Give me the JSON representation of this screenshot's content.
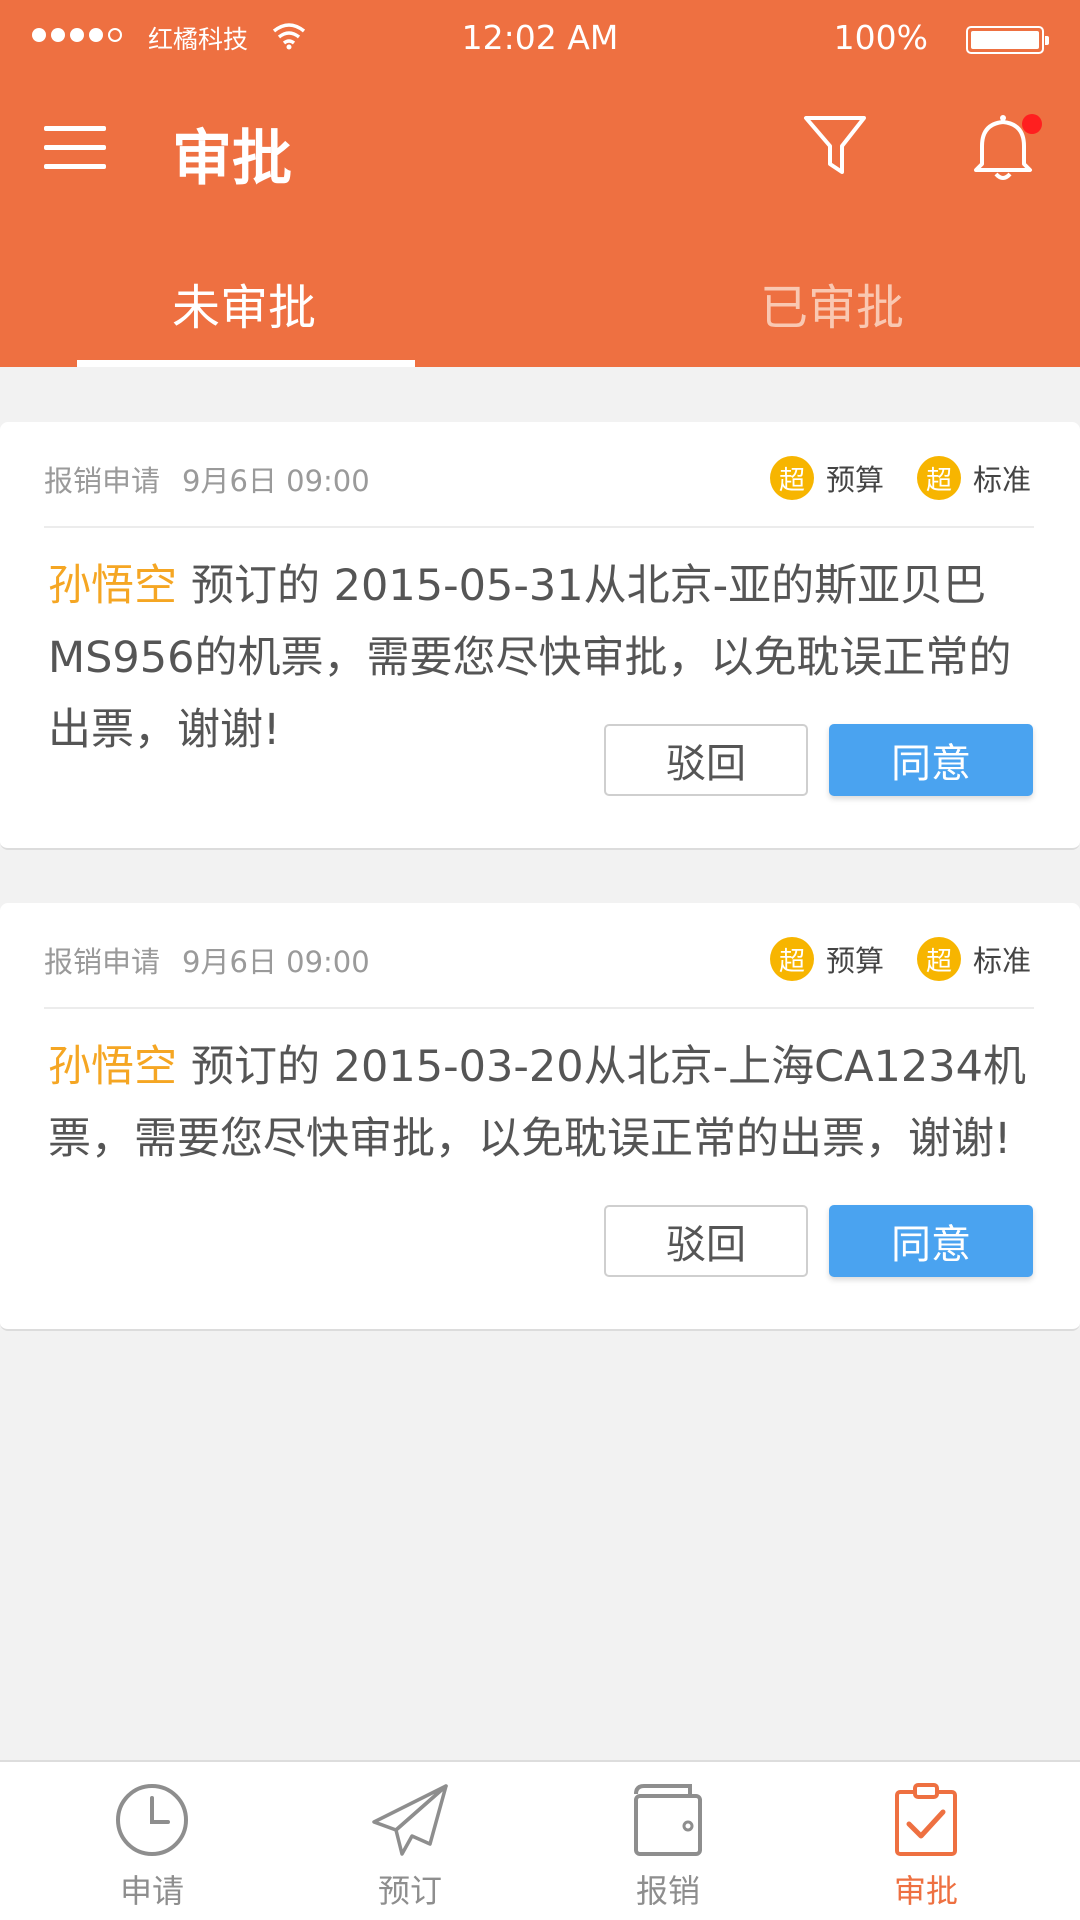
{
  "status_bar": {
    "carrier": "红橘科技",
    "time": "12:02 AM",
    "battery": "100%"
  },
  "header": {
    "title": "审批",
    "icons": [
      "menu-icon",
      "filter-icon",
      "bell-icon"
    ]
  },
  "tabs": [
    {
      "label": "未审批",
      "active": true
    },
    {
      "label": "已审批",
      "active": false
    }
  ],
  "cards": [
    {
      "type": "报销申请",
      "date": "9月6日  09:00",
      "tags": [
        {
          "badge": "超",
          "label": "预算"
        },
        {
          "badge": "超",
          "label": "标准"
        }
      ],
      "name": "孙悟空",
      "message": "预订的 2015-05-31从北京-亚的斯亚贝巴MS956的机票，需要您尽快审批，以免耽误正常的出票，谢谢!",
      "reject_label": "驳回",
      "approve_label": "同意"
    },
    {
      "type": "报销申请",
      "date": "9月6日  09:00",
      "tags": [
        {
          "badge": "超",
          "label": "预算"
        },
        {
          "badge": "超",
          "label": "标准"
        }
      ],
      "name": "孙悟空",
      "message": "预订的 2015-03-20从北京-上海CA1234机票，需要您尽快审批，以免耽误正常的出票，谢谢!",
      "reject_label": "驳回",
      "approve_label": "同意"
    }
  ],
  "bottom_nav": [
    {
      "label": "申请",
      "icon": "clock-icon",
      "active": false
    },
    {
      "label": "预订",
      "icon": "paper-plane-icon",
      "active": false
    },
    {
      "label": "报销",
      "icon": "wallet-icon",
      "active": false
    },
    {
      "label": "审批",
      "icon": "clipboard-check-icon",
      "active": true
    }
  ],
  "colors": {
    "brand": "#ee7041",
    "name_highlight": "#f5a623",
    "approve_button": "#4aa3f0",
    "tag_badge": "#f7b500"
  }
}
